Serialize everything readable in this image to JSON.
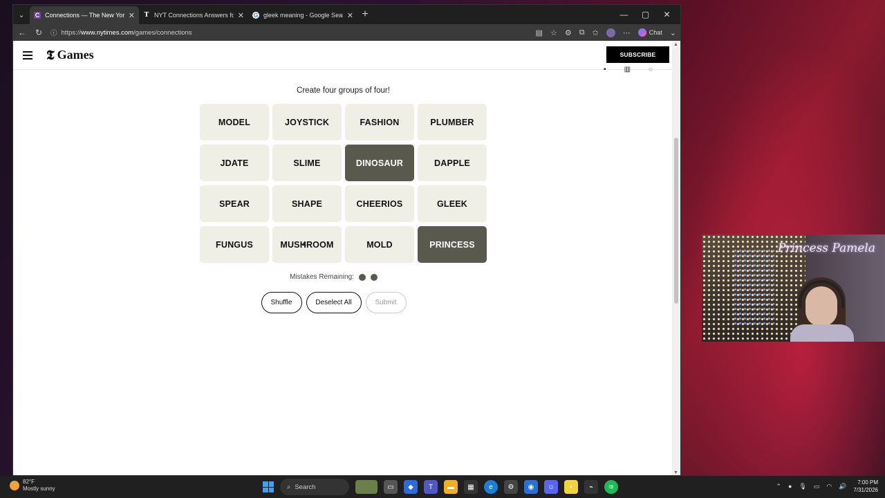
{
  "browser": {
    "tabs": [
      {
        "title": "Connections — The New York Times",
        "fav": "C",
        "active": true
      },
      {
        "title": "NYT Connections Answers for July",
        "fav": "T",
        "active": false
      },
      {
        "title": "gleek meaning - Google Search",
        "fav": "G",
        "active": false
      }
    ],
    "url_prefix": "https://",
    "url_host": "www.nytimes.com",
    "url_path": "/games/connections",
    "chat_label": "Chat"
  },
  "header": {
    "logo": "𝕿",
    "brand": "Games",
    "subscribe": "SUBSCRIBE"
  },
  "game": {
    "instructions": "Create four groups of four!",
    "tiles": [
      {
        "word": "MODEL",
        "selected": false
      },
      {
        "word": "JOYSTICK",
        "selected": false
      },
      {
        "word": "FASHION",
        "selected": false
      },
      {
        "word": "PLUMBER",
        "selected": false
      },
      {
        "word": "JDATE",
        "selected": false
      },
      {
        "word": "SLIME",
        "selected": false
      },
      {
        "word": "DINOSAUR",
        "selected": true
      },
      {
        "word": "DAPPLE",
        "selected": false
      },
      {
        "word": "SPEAR",
        "selected": false
      },
      {
        "word": "SHAPE",
        "selected": false
      },
      {
        "word": "CHEERIOS",
        "selected": false
      },
      {
        "word": "GLEEK",
        "selected": false
      },
      {
        "word": "FUNGUS",
        "selected": false
      },
      {
        "word": "MUSHROOM",
        "selected": false
      },
      {
        "word": "MOLD",
        "selected": false
      },
      {
        "word": "PRINCESS",
        "selected": true
      }
    ],
    "mistakes_label": "Mistakes Remaining:",
    "mistakes_remaining": 2,
    "shuffle_label": "Shuffle",
    "deselect_label": "Deselect All",
    "submit_label": "Submit"
  },
  "overlay": {
    "signature": "Princess Pamela"
  },
  "taskbar": {
    "temperature": "82°F",
    "condition": "Mostly sunny",
    "search_label": "Search",
    "time": "7:00 PM",
    "date": "7/31/2026"
  },
  "colors": {
    "tile_bg": "#efefe6",
    "tile_selected": "#5a594e"
  }
}
